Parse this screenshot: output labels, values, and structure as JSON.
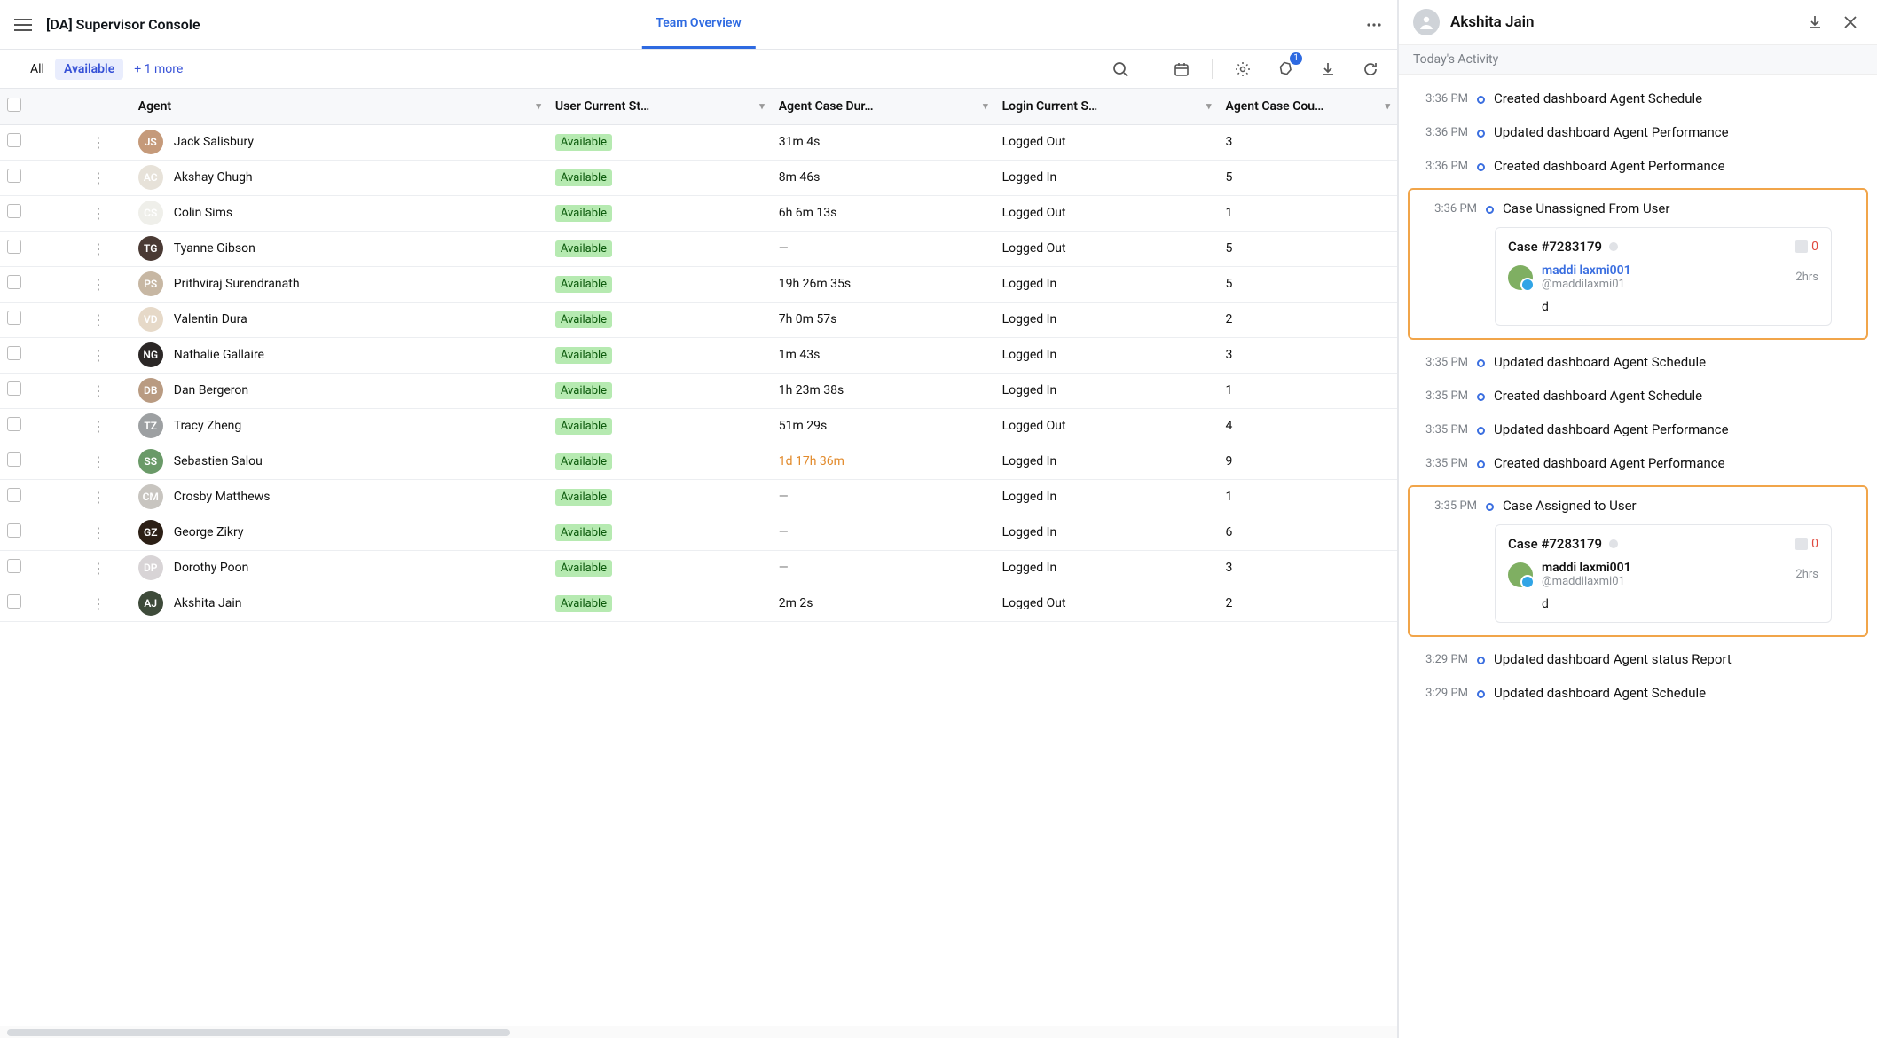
{
  "app": {
    "title": "[DA] Supervisor Console",
    "tabs": [
      {
        "label": "Team Overview"
      }
    ],
    "notification_count": "1"
  },
  "filters": {
    "all_label": "All",
    "active_pill": "Available",
    "more_label": "+ 1 more"
  },
  "table": {
    "headers": {
      "agent": "Agent",
      "status": "User Current St…",
      "duration": "Agent Case Dur…",
      "login": "Login Current S…",
      "count": "Agent Case Cou…"
    },
    "rows": [
      {
        "name": "Jack Salisbury",
        "status": "Available",
        "duration": "31m 4s",
        "login": "Logged Out",
        "count": "3",
        "avatar_bg": "#c59a7a"
      },
      {
        "name": "Akshay Chugh",
        "status": "Available",
        "duration": "8m 46s",
        "login": "Logged In",
        "count": "5",
        "avatar_bg": "#e7e2d9"
      },
      {
        "name": "Colin Sims",
        "status": "Available",
        "duration": "6h 6m 13s",
        "login": "Logged Out",
        "count": "1",
        "avatar_bg": "#efefea"
      },
      {
        "name": "Tyanne Gibson",
        "status": "Available",
        "duration": "—",
        "login": "Logged Out",
        "count": "5",
        "avatar_bg": "#4a3a34",
        "dash": true
      },
      {
        "name": "Prithviraj Surendranath",
        "status": "Available",
        "duration": "19h 26m 35s",
        "login": "Logged In",
        "count": "5",
        "avatar_bg": "#c7b7a3"
      },
      {
        "name": "Valentin Dura",
        "status": "Available",
        "duration": "7h 0m 57s",
        "login": "Logged In",
        "count": "2",
        "avatar_bg": "#e6d9c8"
      },
      {
        "name": "Nathalie Gallaire",
        "status": "Available",
        "duration": "1m 43s",
        "login": "Logged In",
        "count": "3",
        "avatar_bg": "#2b2726"
      },
      {
        "name": "Dan Bergeron",
        "status": "Available",
        "duration": "1h 23m 38s",
        "login": "Logged In",
        "count": "1",
        "avatar_bg": "#b99b82"
      },
      {
        "name": "Tracy Zheng",
        "status": "Available",
        "duration": "51m 29s",
        "login": "Logged Out",
        "count": "4",
        "avatar_bg": "#9da0a2"
      },
      {
        "name": "Sebastien Salou",
        "status": "Available",
        "duration": "1d 17h 36m",
        "login": "Logged In",
        "count": "9",
        "avatar_bg": "#6a9a68",
        "warn": true
      },
      {
        "name": "Crosby Matthews",
        "status": "Available",
        "duration": "—",
        "login": "Logged In",
        "count": "1",
        "avatar_bg": "#c8c5c0",
        "dash": true
      },
      {
        "name": "George Zikry",
        "status": "Available",
        "duration": "—",
        "login": "Logged In",
        "count": "6",
        "avatar_bg": "#2c1f15",
        "dash": true
      },
      {
        "name": "Dorothy Poon",
        "status": "Available",
        "duration": "—",
        "login": "Logged In",
        "count": "3",
        "avatar_bg": "#d8d4d6",
        "dash": true
      },
      {
        "name": "Akshita Jain",
        "status": "Available",
        "duration": "2m 2s",
        "login": "Logged Out",
        "count": "2",
        "avatar_bg": "#3e4b3a"
      }
    ]
  },
  "panel": {
    "title": "Akshita Jain",
    "subtitle": "Today's Activity",
    "events": [
      {
        "time": "3:36 PM",
        "text": "Created dashboard Agent Schedule"
      },
      {
        "time": "3:36 PM",
        "text": "Updated dashboard Agent Performance"
      },
      {
        "time": "3:36 PM",
        "text": "Created dashboard Agent Performance"
      },
      {
        "time": "3:36 PM",
        "text": "Case Unassigned From User",
        "highlight": true,
        "card": {
          "title": "Case #7283179",
          "comments": "0",
          "user_display": "maddi laxmi001",
          "user_handle": "@maddilaxmi01",
          "age": "2hrs",
          "body": "d",
          "link": true
        }
      },
      {
        "time": "3:35 PM",
        "text": "Updated dashboard Agent Schedule"
      },
      {
        "time": "3:35 PM",
        "text": "Created dashboard Agent Schedule"
      },
      {
        "time": "3:35 PM",
        "text": "Updated dashboard Agent Performance"
      },
      {
        "time": "3:35 PM",
        "text": "Created dashboard Agent Performance"
      },
      {
        "time": "3:35 PM",
        "text": "Case Assigned to User",
        "highlight": true,
        "card": {
          "title": "Case #7283179",
          "comments": "0",
          "user_display": "maddi laxmi001",
          "user_handle": "@maddilaxmi01",
          "age": "2hrs",
          "body": "d",
          "link": false
        }
      },
      {
        "time": "3:29 PM",
        "text": "Updated dashboard Agent status Report"
      },
      {
        "time": "3:29 PM",
        "text": "Updated dashboard Agent Schedule"
      }
    ]
  }
}
